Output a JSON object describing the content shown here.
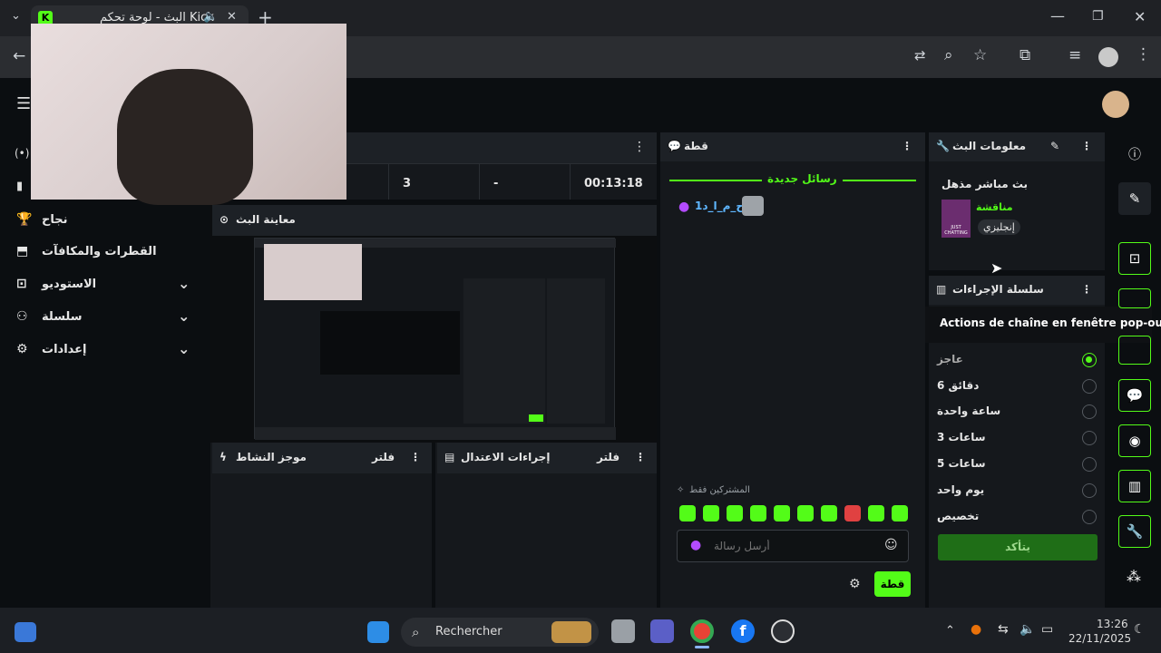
{
  "browser": {
    "tab_title": "البث - لوحة تحكم Kick",
    "tab_icon": "kick-logo",
    "new_tab": "+",
    "window_controls": {
      "minimize": "—",
      "maximize": "❐",
      "close": "✕"
    }
  },
  "header": {
    "menu_icon": "hamburger-icon",
    "avatar_icon": "avatar"
  },
  "sidebar": {
    "items": [
      {
        "label": "نجاح",
        "icon": "trophy-icon"
      },
      {
        "label": "القطرات والمكافآت",
        "icon": "gift-icon"
      },
      {
        "label": "الاستوديو",
        "icon": "studio-icon"
      },
      {
        "label": "سلسلة",
        "icon": "chain-icon"
      },
      {
        "label": "إعدادات",
        "icon": "gear-icon"
      }
    ]
  },
  "stats": {
    "viewers": "3",
    "followers": "-",
    "duration": "00:13:18"
  },
  "preview": {
    "title": "معاينة البث"
  },
  "activity": {
    "title": "موجز النشاط",
    "filter": "فلتر"
  },
  "moderation": {
    "title": "إجراءات الاعتدال",
    "filter": "فلتر"
  },
  "chat": {
    "title": "قطة",
    "new_messages": "رسائل جديدة",
    "message_user": "أ_ح_م_ا_د1",
    "subscribers_only": "المشتركين فقط",
    "placeholder": "أرسل رسالة",
    "send_label": "قطة"
  },
  "stream_info": {
    "title": "معلومات البث",
    "stream_title": "بث مباشر مذهل",
    "category": "مناقشة",
    "language": "إنجليزي",
    "category_thumb_text": "JUST CHATTING"
  },
  "chain_actions": {
    "title": "سلسلة الإجراءات",
    "tooltip": "Actions de chaîne en fenêtre pop-out",
    "options": [
      {
        "label": "عاجز",
        "selected": true
      },
      {
        "label": "6 دقائق",
        "selected": false
      },
      {
        "label": "ساعة واحدة",
        "selected": false
      },
      {
        "label": "3 ساعات",
        "selected": false
      },
      {
        "label": "5 ساعات",
        "selected": false
      },
      {
        "label": "يوم واحد",
        "selected": false
      },
      {
        "label": "تخصيص",
        "selected": false
      }
    ],
    "confirm_label": "يتأكد"
  },
  "taskbar": {
    "search_placeholder": "Rechercher",
    "time": "13:26",
    "date": "22/11/2025"
  },
  "colors": {
    "accent": "#53fc18",
    "panel": "#15181c",
    "background": "#0b0e11"
  }
}
